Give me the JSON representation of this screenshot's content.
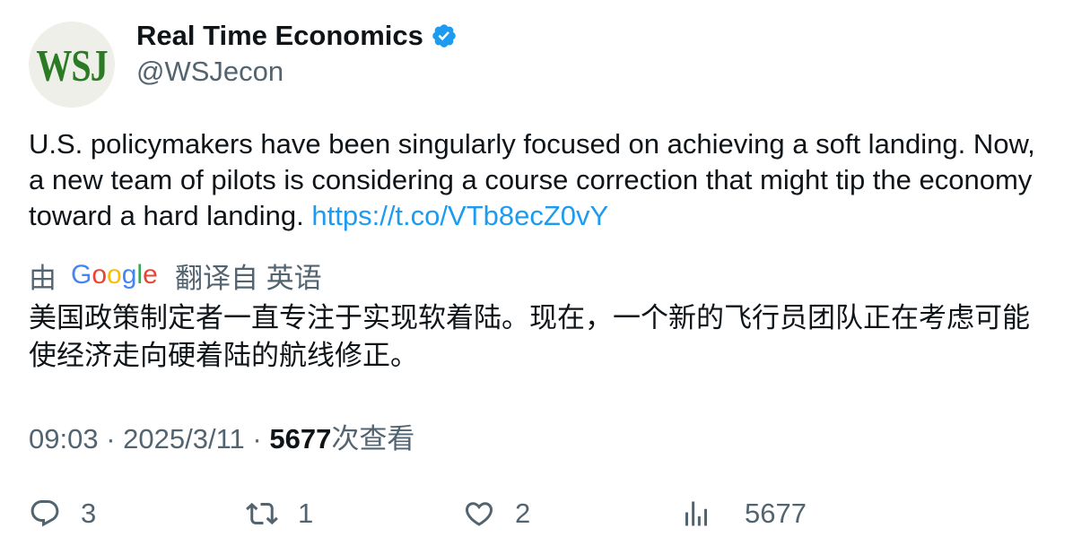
{
  "author": {
    "avatar_text": "WSJ",
    "name": "Real Time Economics",
    "handle": "@WSJecon",
    "verified": true
  },
  "tweet": {
    "text": "U.S. policymakers have been singularly focused on achieving a soft landing. Now, a new team of pilots is considering a course correction that might tip the economy toward a hard landing.",
    "link": "https://t.co/VTb8ecZ0vY"
  },
  "translation": {
    "by_label": "由",
    "provider": "Google",
    "from_label": "翻译自 英语",
    "text": "美国政策制定者一直专注于实现软着陆。现在，一个新的飞行员团队正在考虑可能使经济走向硬着陆的航线修正。"
  },
  "meta": {
    "time": "09:03",
    "separator": "·",
    "date": "2025/3/11",
    "views_count": "5677",
    "views_label": "次查看"
  },
  "actions": {
    "reply_count": "3",
    "retweet_count": "1",
    "like_count": "2",
    "views_count": "5677"
  },
  "colors": {
    "text_primary": "#0f1419",
    "text_secondary": "#536471",
    "link": "#1d9bf0",
    "verified": "#1d9bf0",
    "avatar_bg": "#efefe9",
    "avatar_text": "#2b7a24"
  },
  "icons": [
    "verified-badge-icon",
    "google-logo",
    "reply-icon",
    "retweet-icon",
    "like-icon",
    "views-icon"
  ]
}
